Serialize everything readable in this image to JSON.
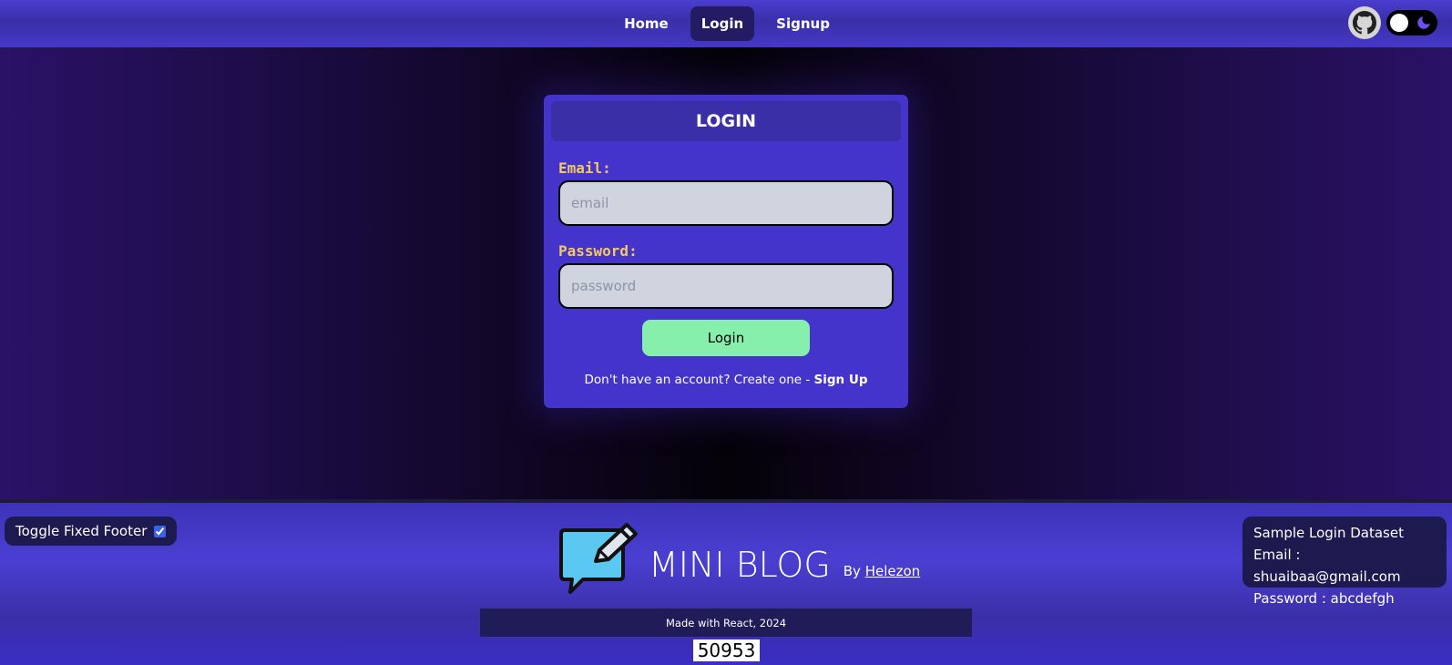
{
  "nav": {
    "links": [
      "Home",
      "Login",
      "Signup"
    ],
    "active": "Login",
    "github_icon": "github-icon",
    "theme_toggle_icon": "moon-icon"
  },
  "login": {
    "title": "LOGIN",
    "email_label": "Email:",
    "email_placeholder": "email",
    "email_value": "",
    "password_label": "Password:",
    "password_placeholder": "password",
    "password_value": "",
    "button_label": "Login",
    "signup_prompt": "Don't have an account? Create one - ",
    "signup_link": "Sign Up"
  },
  "footer": {
    "fixed_footer_label": "Toggle Fixed Footer",
    "fixed_footer_checked": true,
    "brand_name": "MINI BLOG",
    "by_label": "By",
    "author": "Helezon",
    "made_with": "Made with React, 2024",
    "counter": "50953",
    "sample": {
      "title": "Sample Login Dataset",
      "email_line": "Email : shuaibaa@gmail.com",
      "password_line": "Password : abcdefgh"
    }
  },
  "colors": {
    "accent": "#4434cc",
    "label": "#f4c95d",
    "button": "#86efac",
    "nav_active": "#231b63",
    "footer_box": "#1d1a4f"
  }
}
